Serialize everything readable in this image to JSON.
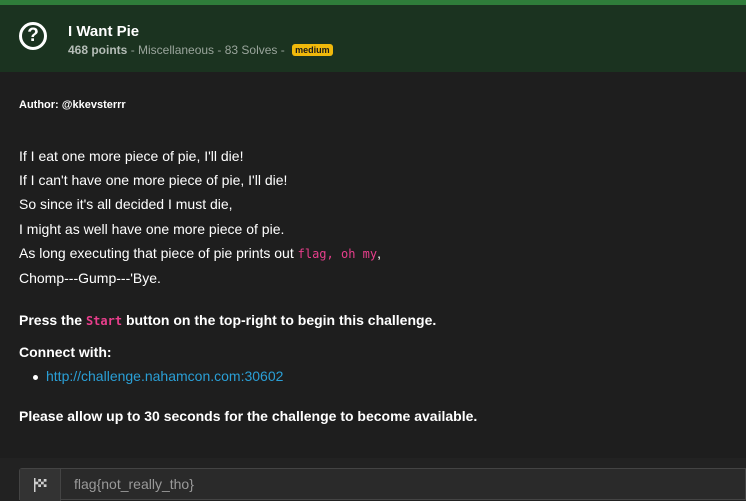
{
  "challenge": {
    "title": "I Want Pie",
    "points": "468 points",
    "meta_rest": " - Miscellaneous - 83 Solves - ",
    "difficulty": "medium"
  },
  "description": {
    "author": "Author: @kkevsterrr",
    "poem": {
      "line1": "If I eat one more piece of pie, I'll die!",
      "line2": "If I can't have one more piece of pie, I'll die!",
      "line3": "So since it's all decided I must die,",
      "line4": "I might as well have one more piece of pie.",
      "line5_prefix": "As long executing that piece of pie prints out ",
      "line5_code": "flag, oh my",
      "line5_suffix": ",",
      "line6": "Chomp---Gump---'Bye."
    },
    "press_prefix": "Press the ",
    "press_code": "Start",
    "press_suffix": " button on the top-right to begin this challenge.",
    "connect_label": "Connect with:",
    "connect_link": "http://challenge.nahamcon.com:30602",
    "allow_text": "Please allow up to 30 seconds for the challenge to become available."
  },
  "flag_input": {
    "value": "flag{not_really_tho}",
    "icon": "checkered-flag-icon"
  },
  "colors": {
    "header_bg": "#1b3320",
    "accent_green": "#2f7d3a",
    "badge": "#f0b90b",
    "code": "#e83e8c",
    "link": "#2a9fd6"
  }
}
